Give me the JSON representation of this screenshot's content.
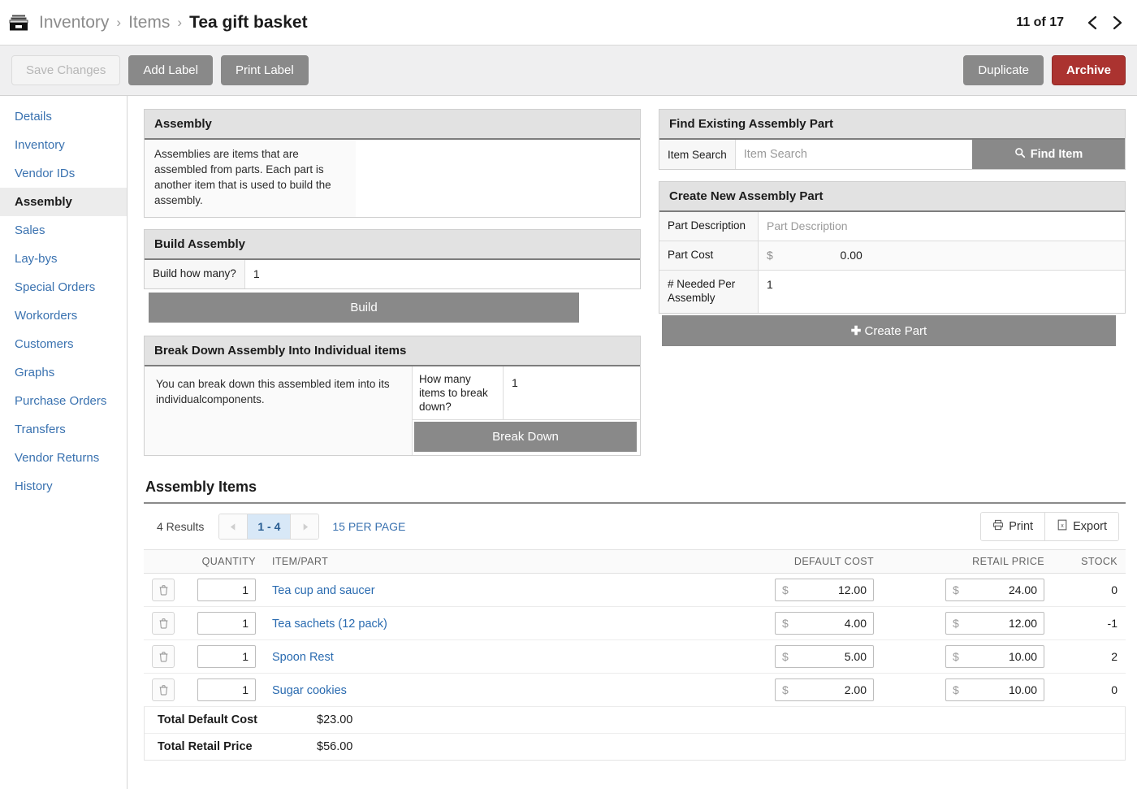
{
  "breadcrumb": {
    "icon": "archive-box-icon",
    "items": [
      {
        "label": "Inventory",
        "current": false
      },
      {
        "label": "Items",
        "current": false
      },
      {
        "label": "Tea gift basket",
        "current": true
      }
    ],
    "separator": "›"
  },
  "pager": {
    "count_text": "11 of 17",
    "prev_icon": "chevron-left-icon",
    "next_icon": "chevron-right-icon"
  },
  "toolbar": {
    "save_label": "Save Changes",
    "add_label": "Add Label",
    "print_label": "Print Label",
    "duplicate_label": "Duplicate",
    "archive_label": "Archive"
  },
  "sidebar": {
    "items": [
      {
        "label": "Details",
        "active": false
      },
      {
        "label": "Inventory",
        "active": false
      },
      {
        "label": "Vendor IDs",
        "active": false
      },
      {
        "label": "Assembly",
        "active": true
      },
      {
        "label": "Sales",
        "active": false
      },
      {
        "label": "Lay-bys",
        "active": false
      },
      {
        "label": "Special Orders",
        "active": false
      },
      {
        "label": "Workorders",
        "active": false
      },
      {
        "label": "Customers",
        "active": false
      },
      {
        "label": "Graphs",
        "active": false
      },
      {
        "label": "Purchase Orders",
        "active": false
      },
      {
        "label": "Transfers",
        "active": false
      },
      {
        "label": "Vendor Returns",
        "active": false
      },
      {
        "label": "History",
        "active": false
      }
    ]
  },
  "assembly_panel": {
    "title": "Assembly",
    "description": "Assemblies are items that are assembled from parts. Each part is another item that is used to build the assembly."
  },
  "build_panel": {
    "title": "Build Assembly",
    "qty_label": "Build how many?",
    "qty_value": "1",
    "build_button": "Build"
  },
  "breakdown_panel": {
    "title": "Break Down Assembly Into Individual items",
    "description": "You can break down this assembled item into its individualcomponents.",
    "qty_label": "How many items to break down?",
    "qty_value": "1",
    "button": "Break Down"
  },
  "find_panel": {
    "title": "Find Existing Assembly Part",
    "label": "Item Search",
    "placeholder": "Item Search",
    "button": "Find Item",
    "button_icon": "search-icon"
  },
  "create_panel": {
    "title": "Create New Assembly Part",
    "rows": [
      {
        "label": "Part Description",
        "value": "Part Description",
        "is_placeholder": true
      },
      {
        "label": "Part Cost",
        "symbol": "$",
        "value": "0.00",
        "is_money": true
      },
      {
        "label": "# Needed Per Assembly",
        "value": "1",
        "is_placeholder": false
      }
    ],
    "button": "Create Part",
    "button_icon": "plus-icon"
  },
  "items_section": {
    "title": "Assembly Items",
    "results_text": "4 Results",
    "page_range": "1 - 4",
    "per_page": "15 PER PAGE",
    "prev_icon": "caret-left-icon",
    "next_icon": "caret-right-icon",
    "print_label": "Print",
    "print_icon": "printer-icon",
    "export_label": "Export",
    "export_icon": "spreadsheet-icon",
    "columns": {
      "quantity": "QUANTITY",
      "item": "ITEM/PART",
      "default_cost": "DEFAULT COST",
      "retail_price": "RETAIL PRICE",
      "stock": "STOCK"
    },
    "currency_symbol": "$",
    "rows": [
      {
        "delete_icon": "trash-icon",
        "quantity": "1",
        "name": "Tea cup and saucer",
        "default_cost": "12.00",
        "retail_price": "24.00",
        "stock": "0"
      },
      {
        "delete_icon": "trash-icon",
        "quantity": "1",
        "name": "Tea sachets (12 pack)",
        "default_cost": "4.00",
        "retail_price": "12.00",
        "stock": "-1"
      },
      {
        "delete_icon": "trash-icon",
        "quantity": "1",
        "name": "Spoon Rest",
        "default_cost": "5.00",
        "retail_price": "10.00",
        "stock": "2"
      },
      {
        "delete_icon": "trash-icon",
        "quantity": "1",
        "name": "Sugar cookies",
        "default_cost": "2.00",
        "retail_price": "10.00",
        "stock": "0"
      }
    ],
    "totals": [
      {
        "label": "Total Default Cost",
        "value": "$23.00"
      },
      {
        "label": "Total Retail Price",
        "value": "$56.00"
      }
    ]
  },
  "colors": {
    "link_blue": "#3a72b0",
    "item_link_blue": "#2a6bb0",
    "archive_red": "#ab3330",
    "button_gray": "#898989",
    "panel_head_gray": "#e2e2e2",
    "active_nav_bg": "#ececec",
    "pager_active_bg": "#d8e8f7"
  }
}
